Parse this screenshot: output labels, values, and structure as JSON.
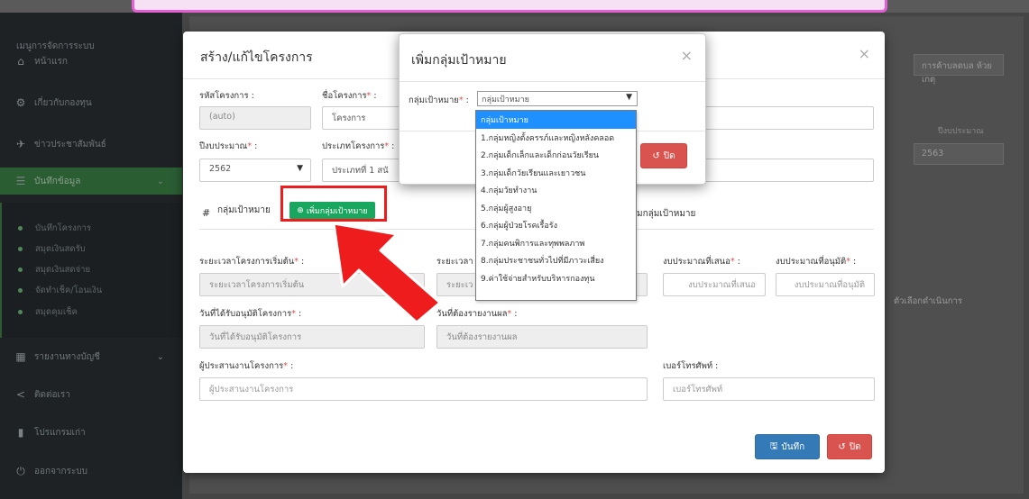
{
  "sidebar": {
    "menu_title": "เมนูการจัดการระบบ",
    "items": [
      {
        "label": "หน้าแรก",
        "icon": "home-icon",
        "glyph": "⌂"
      },
      {
        "label": "เกี่ยวกับกองทุน",
        "icon": "cogs-icon",
        "glyph": "⚙"
      },
      {
        "label": "ข่าวประชาสัมพันธ์",
        "icon": "megaphone-icon",
        "glyph": "✈"
      },
      {
        "label": "บันทึกข้อมูล",
        "icon": "database-icon",
        "glyph": "☰"
      },
      {
        "label": "รายงานทางบัญชี",
        "icon": "table-icon",
        "glyph": "▦"
      },
      {
        "label": "ติดต่อเรา",
        "icon": "share-icon",
        "glyph": "<"
      },
      {
        "label": "โปรแกรมเก่า",
        "icon": "bar-chart-icon",
        "glyph": "▮"
      },
      {
        "label": "ออกจากระบบ",
        "icon": "power-icon",
        "glyph": "⏻"
      }
    ],
    "sub_items": [
      "บันทึกโครงการ",
      "สมุดเงินสดรับ",
      "สมุดเงินสดจ่าย",
      "จัดทำเช็ค/โอนเงิน",
      "สมุดคุมเช็ค"
    ]
  },
  "background": {
    "org_select": "การค้าบลดบล ห้วยเกตุ",
    "budget_year_label": "ปีงบประมาณ",
    "budget_year_value": "2563",
    "status_select": "ตัวเลือกดำเนินการ"
  },
  "modal": {
    "title": "สร้าง/แก้ไขโครงการ",
    "close_glyph": "×",
    "project_code_label": "รหัสโครงการ :",
    "project_code_value": "(auto)",
    "project_name_label": "ชื่อโครงการ",
    "project_name_value": "โครงการ",
    "budget_year_label": "ปีงบประมาณ",
    "budget_year_value": "2562",
    "project_type_label": "ประเภทโครงการ",
    "project_type_value": "ประเภทที่ 1 สนั",
    "hash": "#",
    "target_group_label": "กลุ่มเป้าหมาย",
    "add_target_button": "เพิ่มกลุ่มเป้าหมาย",
    "target_group_col2": "มกลุ่มเป้าหมาย",
    "start_period_label": "ระยะเวลาโครงการเริ่มต้น",
    "start_period_placeholder": "ระยะเวลาโครงการเริ่มต้น",
    "end_period_label": "ระยะเวลา",
    "end_period_placeholder": "ระยะเว",
    "proposed_budget_label": "งบประมาณที่เสนอ",
    "proposed_budget_placeholder": "งบประมาณที่เสนอ",
    "approved_budget_label": "งบประมาณที่อนุมัติ",
    "approved_budget_placeholder": "งบประมาณที่อนุมัติ",
    "approval_date_label": "วันที่ได้รับอนุมัติโครงการ",
    "approval_date_placeholder": "วันที่ได้รับอนุมัติโครงการ",
    "report_date_label": "วันที่ต้องรายงานผล",
    "report_date_placeholder": "วันที่ต้องรายงานผล",
    "coordinator_label": "ผู้ประสานงานโครงการ",
    "coordinator_placeholder": "ผู้ประสานงานโครงการ",
    "phone_label": "เบอร์โทรศัพท์ :",
    "phone_placeholder": "เบอร์โทรศัพท์",
    "save_button": "บันทึก",
    "close_button": "ปิด",
    "required_mark": "*",
    "colon": " :"
  },
  "inner_modal": {
    "title": "เพิ่มกลุ่มเป้าหมาย",
    "close_glyph": "×",
    "target_label": "กลุ่มเป้าหมาย",
    "select_value": "กลุ่มเป้าหมาย",
    "close_button": "ปิด",
    "options": [
      "กลุ่มเป้าหมาย",
      "1.กลุ่มหญิงตั้งครรภ์และหญิงหลังคลอด",
      "2.กลุ่มเด็กเล็กและเด็กก่อนวัยเรียน",
      "3.กลุ่มเด็กวัยเรียนและเยาวชน",
      "4.กลุ่มวัยทำงาน",
      "5.กลุ่มผู้สูงอายุ",
      "6.กลุ่มผู้ป่วยโรคเรื้อรัง",
      "7.กลุ่มคนพิการและทุพพลภาพ",
      "8.กลุ่มประชาชนทั่วไปที่มีภาวะเสี่ยง",
      "9.ค่าใช้จ่ายสำหรับบริหารกองทุน"
    ]
  },
  "colors": {
    "highlight_red": "#ee1c1c",
    "pink_banner": "#e45fd6",
    "primary_blue": "#337ab7",
    "danger_red": "#d9534f",
    "success_green": "#19a65e"
  }
}
